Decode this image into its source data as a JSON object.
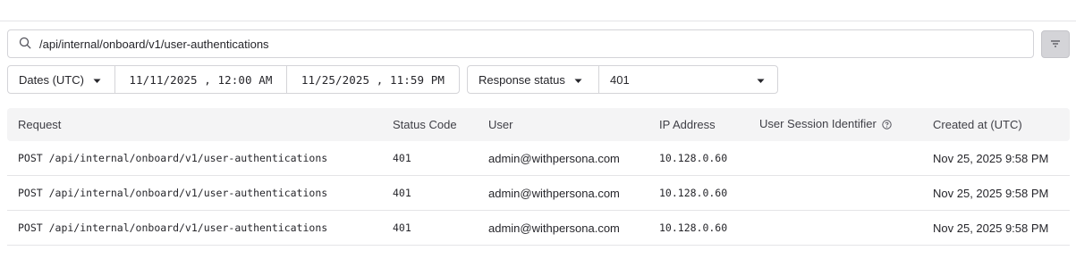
{
  "search": {
    "value": "/api/internal/onboard/v1/user-authentications"
  },
  "icons": {
    "search": "search-icon",
    "filter": "filter-icon",
    "caret": "caret-down-icon",
    "help": "help-circle-icon"
  },
  "filters": {
    "dates_label": "Dates (UTC)",
    "date_start": "11/11/2025 , 12:00 AM",
    "date_end": "11/25/2025 , 11:59 PM",
    "status_label": "Response status",
    "status_value": "401"
  },
  "table": {
    "headers": {
      "request": "Request",
      "status_code": "Status Code",
      "user": "User",
      "ip_address": "IP Address",
      "session": "User Session Identifier",
      "created_at": "Created at (UTC)"
    },
    "rows": [
      {
        "request": "POST /api/internal/onboard/v1/user-authentications",
        "status_code": "401",
        "user": "admin@withpersona.com",
        "ip_address": "10.128.0.60",
        "session": "",
        "created_at": "Nov 25, 2025 9:58 PM"
      },
      {
        "request": "POST /api/internal/onboard/v1/user-authentications",
        "status_code": "401",
        "user": "admin@withpersona.com",
        "ip_address": "10.128.0.60",
        "session": "",
        "created_at": "Nov 25, 2025 9:58 PM"
      },
      {
        "request": "POST /api/internal/onboard/v1/user-authentications",
        "status_code": "401",
        "user": "admin@withpersona.com",
        "ip_address": "10.128.0.60",
        "session": "",
        "created_at": "Nov 25, 2025 9:58 PM"
      }
    ]
  }
}
